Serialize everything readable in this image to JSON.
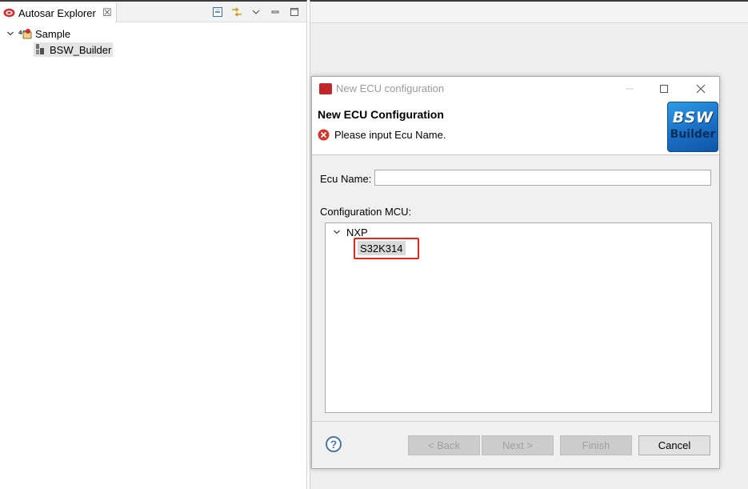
{
  "explorer": {
    "tab_label": "Autosar Explorer",
    "tab_close": "☒",
    "tree": [
      {
        "label": "Sample",
        "expanded": true,
        "icon": "autosar-project-icon"
      },
      {
        "label": "BSW_Builder",
        "selected": true,
        "icon": "bsw-module-icon"
      }
    ]
  },
  "dialog": {
    "window_title": "New ECU configuration",
    "banner": {
      "title": "New ECU Configuration",
      "message": "Please input Ecu Name.",
      "logo_line1": "BSW",
      "logo_line2": "Builder"
    },
    "ecu_name_label": "Ecu Name:",
    "ecu_name_value": "",
    "config_mcu_label": "Configuration MCU:",
    "mcu_tree": {
      "vendor": "NXP",
      "selected_mcu": "S32K314"
    },
    "buttons": {
      "help": "?",
      "back": "< Back",
      "next": "Next >",
      "finish": "Finish",
      "cancel": "Cancel"
    }
  },
  "colors": {
    "highlight_border": "#e8251d",
    "logo_blue": "#1a6fc4",
    "error_red": "#d9342b"
  }
}
